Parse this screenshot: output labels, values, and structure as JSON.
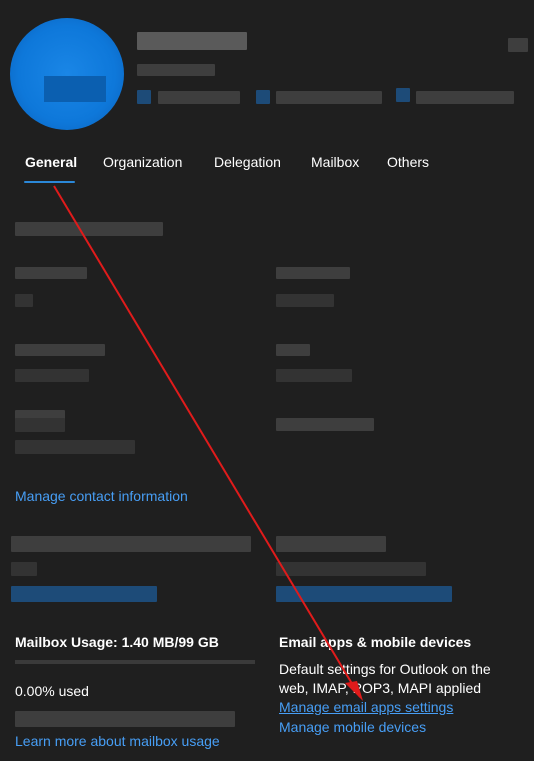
{
  "tabs": [
    {
      "label": "General",
      "active": true
    },
    {
      "label": "Organization",
      "active": false
    },
    {
      "label": "Delegation",
      "active": false
    },
    {
      "label": "Mailbox",
      "active": false
    },
    {
      "label": "Others",
      "active": false
    }
  ],
  "contact": {
    "manage_link": "Manage contact information"
  },
  "mailbox": {
    "usage_heading": "Mailbox Usage: 1.40 MB/99 GB",
    "used_text": "0.00% used",
    "used_fraction": 0.0,
    "learn_more_link": "Learn more about mailbox usage"
  },
  "email_apps": {
    "heading": "Email apps & mobile devices",
    "description_line1": "Default settings for Outlook on the",
    "description_line2": "web, IMAP, POP3, MAPI applied",
    "manage_apps_link": "Manage email apps settings",
    "manage_devices_link": "Manage mobile devices"
  },
  "colors": {
    "background": "#1f1f1f",
    "accent": "#2b88d8",
    "link": "#479ef5",
    "avatar": "#0e78da",
    "annotation_arrow": "#e01b1b"
  }
}
